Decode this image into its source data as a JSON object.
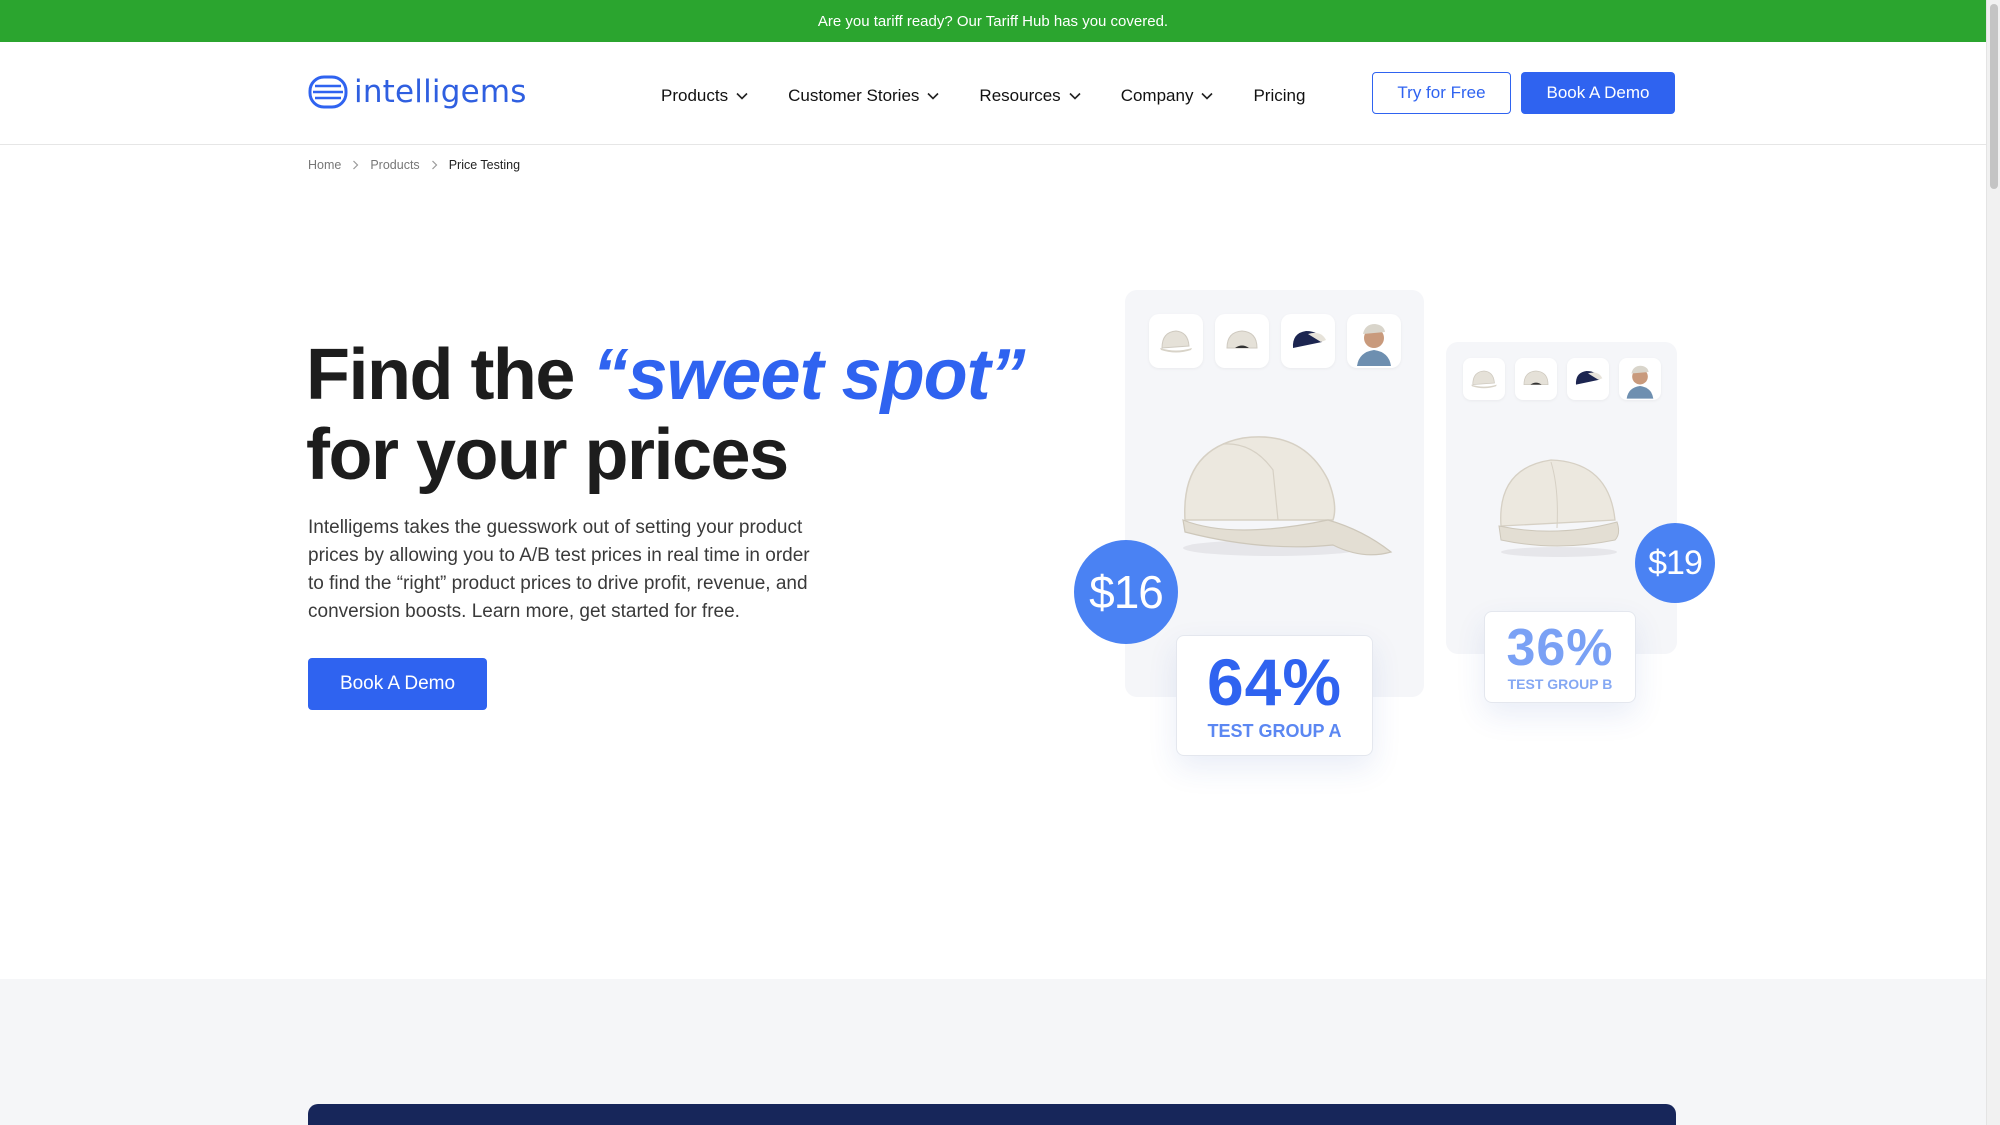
{
  "announcement": {
    "text": "Are you tariff ready? Our Tariff Hub has you covered."
  },
  "brand": {
    "name": "intelligems",
    "color": "#2f63f0"
  },
  "nav": {
    "items": [
      {
        "label": "Products",
        "dropdown": true
      },
      {
        "label": "Customer Stories",
        "dropdown": true
      },
      {
        "label": "Resources",
        "dropdown": true
      },
      {
        "label": "Company",
        "dropdown": true
      },
      {
        "label": "Pricing",
        "dropdown": false
      }
    ],
    "try_free": "Try for Free",
    "book_demo": "Book A Demo"
  },
  "breadcrumb": [
    "Home",
    "Products",
    "Price Testing"
  ],
  "hero": {
    "title_prefix": "Find the ",
    "title_accent": "“sweet spot”",
    "title_suffix": "for your prices",
    "description": "Intelligems takes the guesswork out of setting your product prices by allowing you to A/B test prices in real time in order to find the “right” product prices to drive profit, revenue, and conversion boosts.  Learn more, get started for free.",
    "cta": "Book A Demo"
  },
  "illustration": {
    "group_a": {
      "price": "$16",
      "percent": "64%",
      "label": "TEST GROUP A"
    },
    "group_b": {
      "price": "$19",
      "percent": "36%",
      "label": "TEST GROUP B"
    },
    "thumbnails": [
      "cap-cream-icon",
      "cap-cream-back-icon",
      "cap-navy-icon",
      "model-wearing-cap-icon"
    ]
  },
  "colors": {
    "announcement_bg": "#2ba52f",
    "accent": "#2f63f0",
    "price_badge": "#4a82f3",
    "dark_card": "#17265a"
  }
}
